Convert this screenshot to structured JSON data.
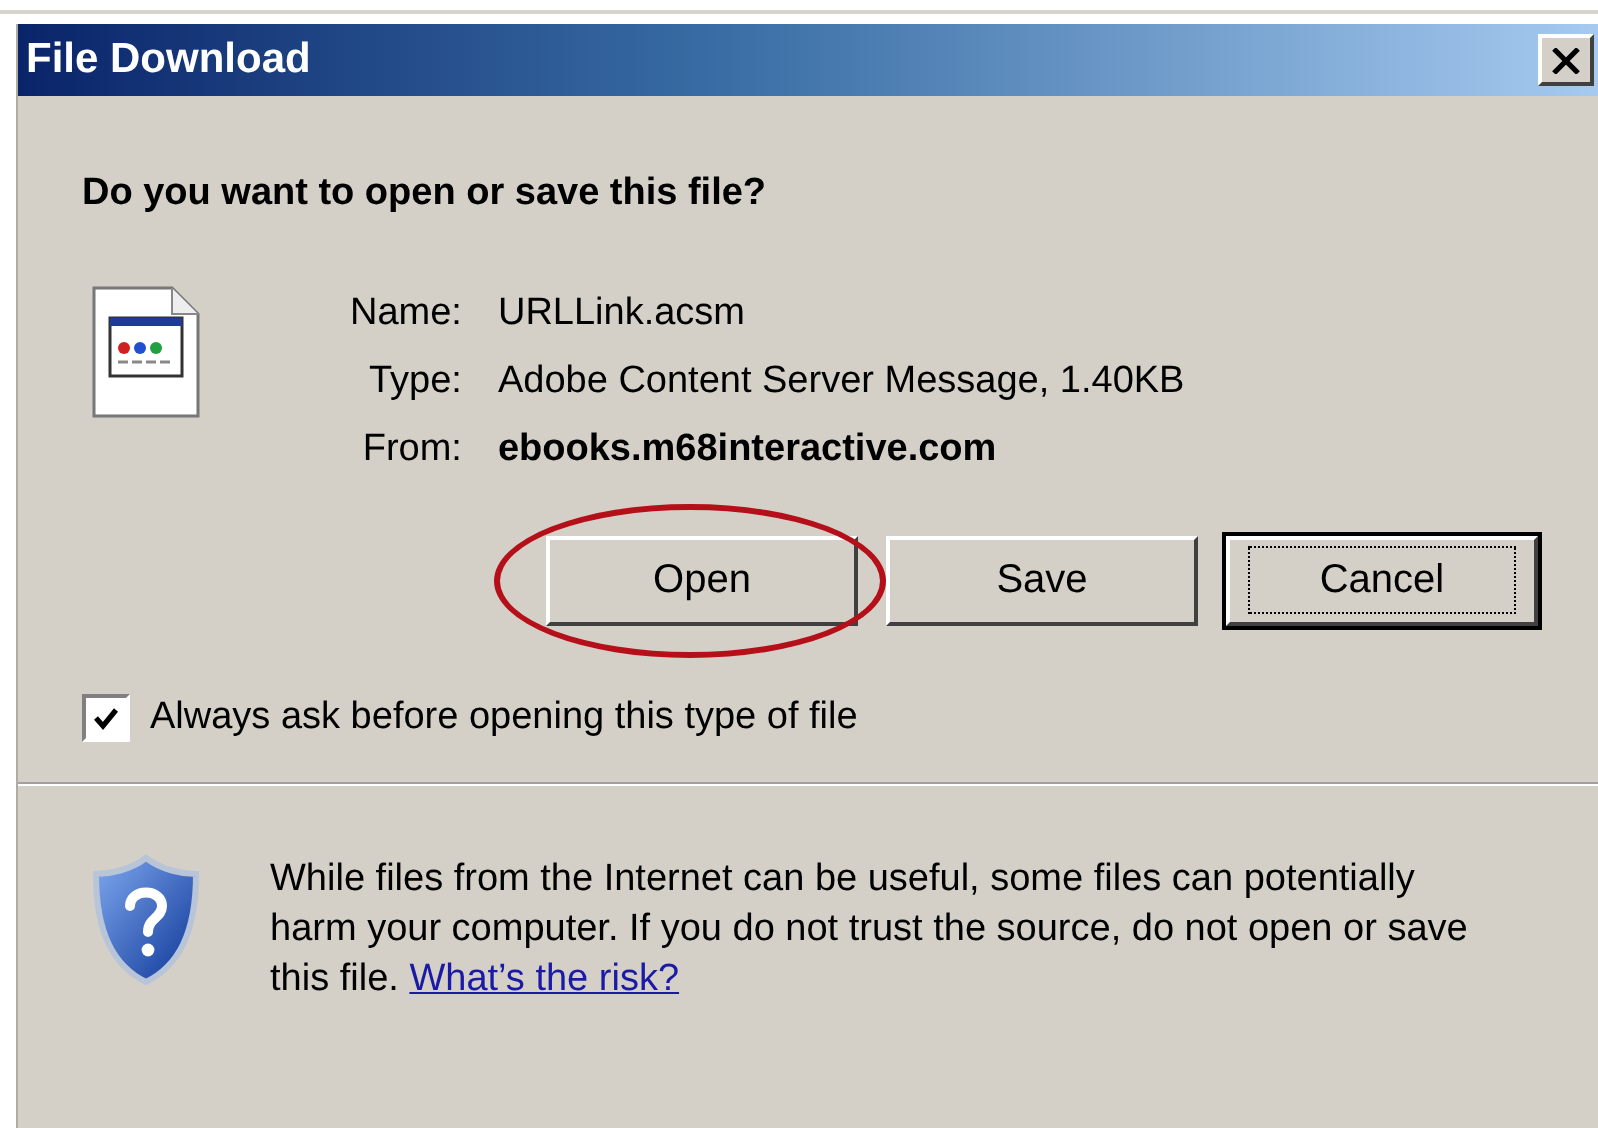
{
  "window": {
    "title": "File Download"
  },
  "heading": "Do you want to open or save this file?",
  "fields": [
    {
      "label": "Name:",
      "value": "URLLink.acsm",
      "bold": false
    },
    {
      "label": "Type:",
      "value": "Adobe Content Server Message, 1.40KB",
      "bold": false
    },
    {
      "label": "From:",
      "value": "ebooks.m68interactive.com",
      "bold": true
    }
  ],
  "buttons": [
    {
      "label": "Open",
      "focused": false,
      "highlighted": true
    },
    {
      "label": "Save",
      "focused": false,
      "highlighted": false
    },
    {
      "label": "Cancel",
      "focused": true,
      "highlighted": false
    }
  ],
  "checkbox": {
    "label": "Always ask before opening this type of file",
    "checked": true
  },
  "warning": {
    "text": "While files from the Internet can be useful, some files can potentially harm your computer. If you do not trust the source, do not open or save this file.",
    "link": "What’s the risk?"
  }
}
